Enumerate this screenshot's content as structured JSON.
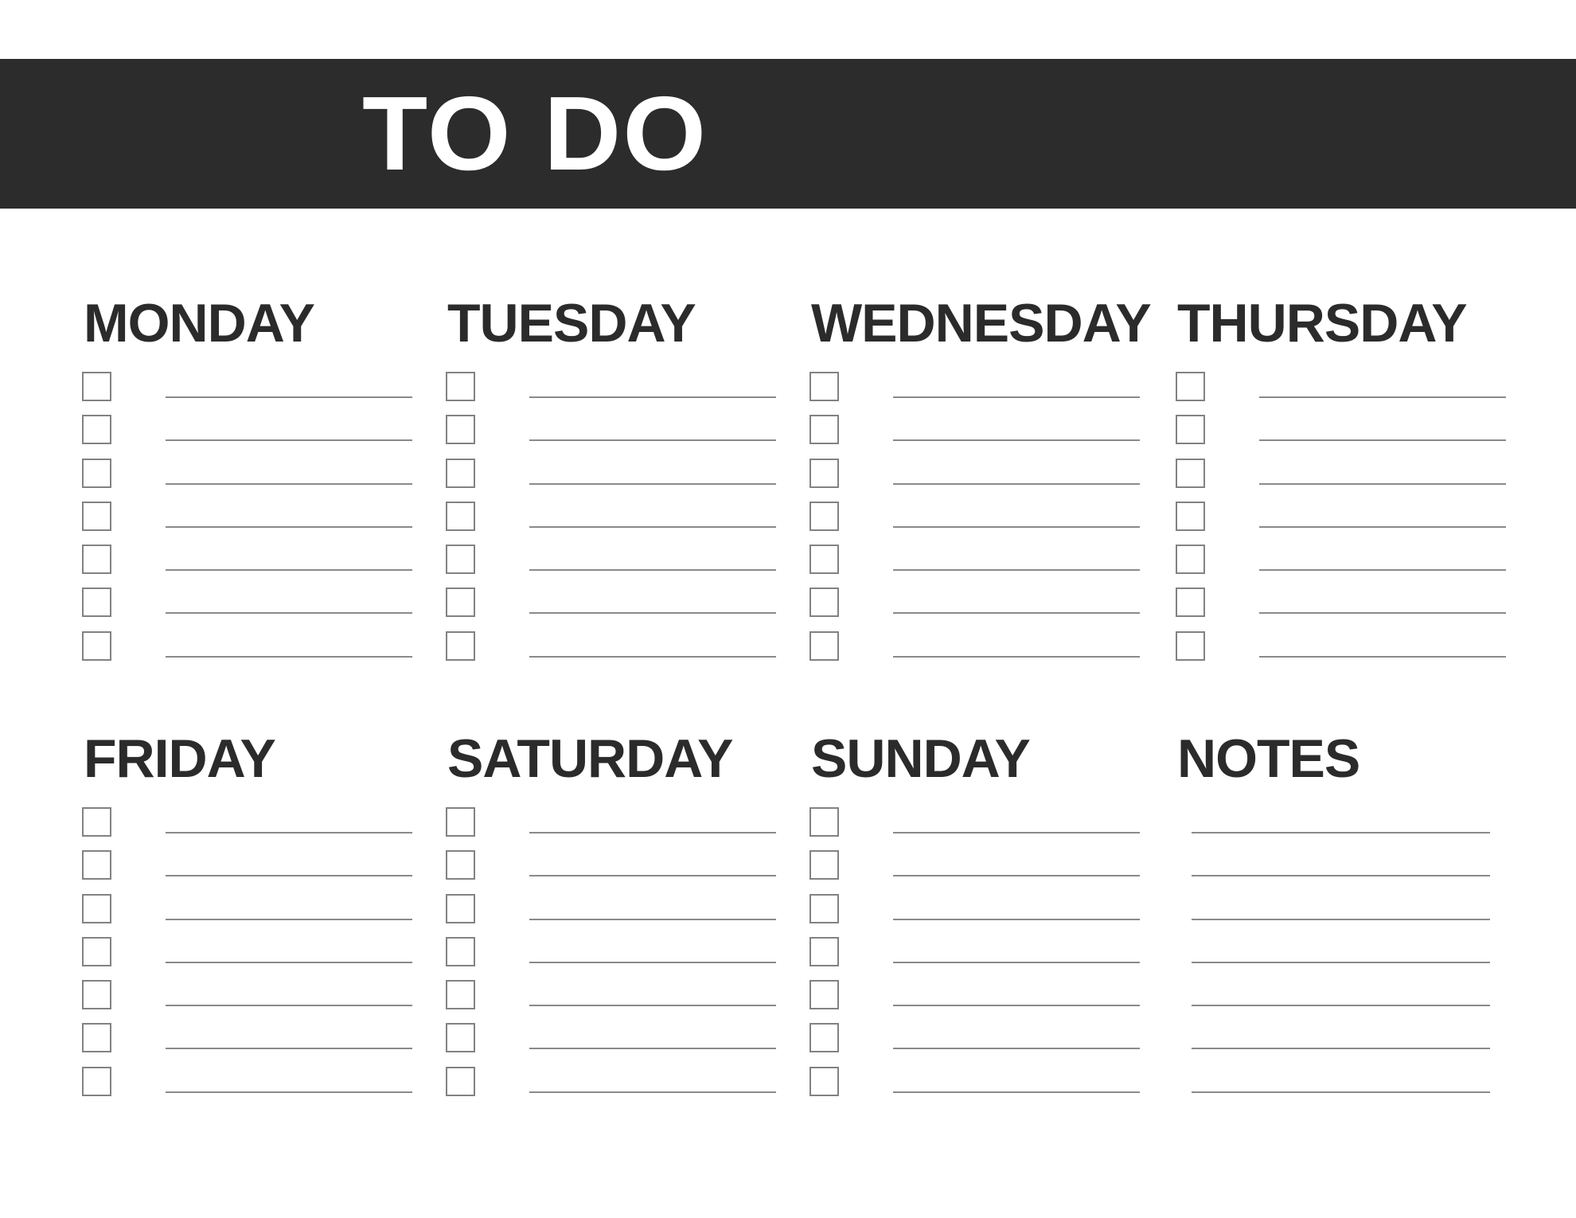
{
  "page": {
    "background_color": "#ffffff",
    "ink_color": "#2b2b2b",
    "header_bar_color": "#2c2c2c",
    "header_text_color": "#ffffff",
    "rule_color": "#8a8a8a",
    "checkbox_border_color": "#828282"
  },
  "header": {
    "title": "TO DO"
  },
  "sections": [
    {
      "id": "monday",
      "label": "MONDAY",
      "checkbox_count": 7,
      "line_count": 7,
      "has_checkboxes": true
    },
    {
      "id": "tuesday",
      "label": "TUESDAY",
      "checkbox_count": 7,
      "line_count": 7,
      "has_checkboxes": true
    },
    {
      "id": "wednesday",
      "label": "WEDNESDAY",
      "checkbox_count": 7,
      "line_count": 7,
      "has_checkboxes": true
    },
    {
      "id": "thursday",
      "label": "THURSDAY",
      "checkbox_count": 7,
      "line_count": 7,
      "has_checkboxes": true
    },
    {
      "id": "friday",
      "label": "FRIDAY",
      "checkbox_count": 7,
      "line_count": 7,
      "has_checkboxes": true
    },
    {
      "id": "saturday",
      "label": "SATURDAY",
      "checkbox_count": 7,
      "line_count": 7,
      "has_checkboxes": true
    },
    {
      "id": "sunday",
      "label": "SUNDAY",
      "checkbox_count": 7,
      "line_count": 7,
      "has_checkboxes": true
    },
    {
      "id": "notes",
      "label": "NOTES",
      "checkbox_count": 0,
      "line_count": 7,
      "has_checkboxes": false
    }
  ],
  "task_values": {
    "monday": [
      "",
      "",
      "",
      "",
      "",
      "",
      ""
    ],
    "tuesday": [
      "",
      "",
      "",
      "",
      "",
      "",
      ""
    ],
    "wednesday": [
      "",
      "",
      "",
      "",
      "",
      "",
      ""
    ],
    "thursday": [
      "",
      "",
      "",
      "",
      "",
      "",
      ""
    ],
    "friday": [
      "",
      "",
      "",
      "",
      "",
      "",
      ""
    ],
    "saturday": [
      "",
      "",
      "",
      "",
      "",
      "",
      ""
    ],
    "sunday": [
      "",
      "",
      "",
      "",
      "",
      "",
      ""
    ],
    "notes": [
      "",
      "",
      "",
      "",
      "",
      "",
      ""
    ]
  },
  "checked_states": {
    "monday": [
      false,
      false,
      false,
      false,
      false,
      false,
      false
    ],
    "tuesday": [
      false,
      false,
      false,
      false,
      false,
      false,
      false
    ],
    "wednesday": [
      false,
      false,
      false,
      false,
      false,
      false,
      false
    ],
    "thursday": [
      false,
      false,
      false,
      false,
      false,
      false,
      false
    ],
    "friday": [
      false,
      false,
      false,
      false,
      false,
      false,
      false
    ],
    "saturday": [
      false,
      false,
      false,
      false,
      false,
      false,
      false
    ],
    "sunday": [
      false,
      false,
      false,
      false,
      false,
      false,
      false
    ]
  }
}
